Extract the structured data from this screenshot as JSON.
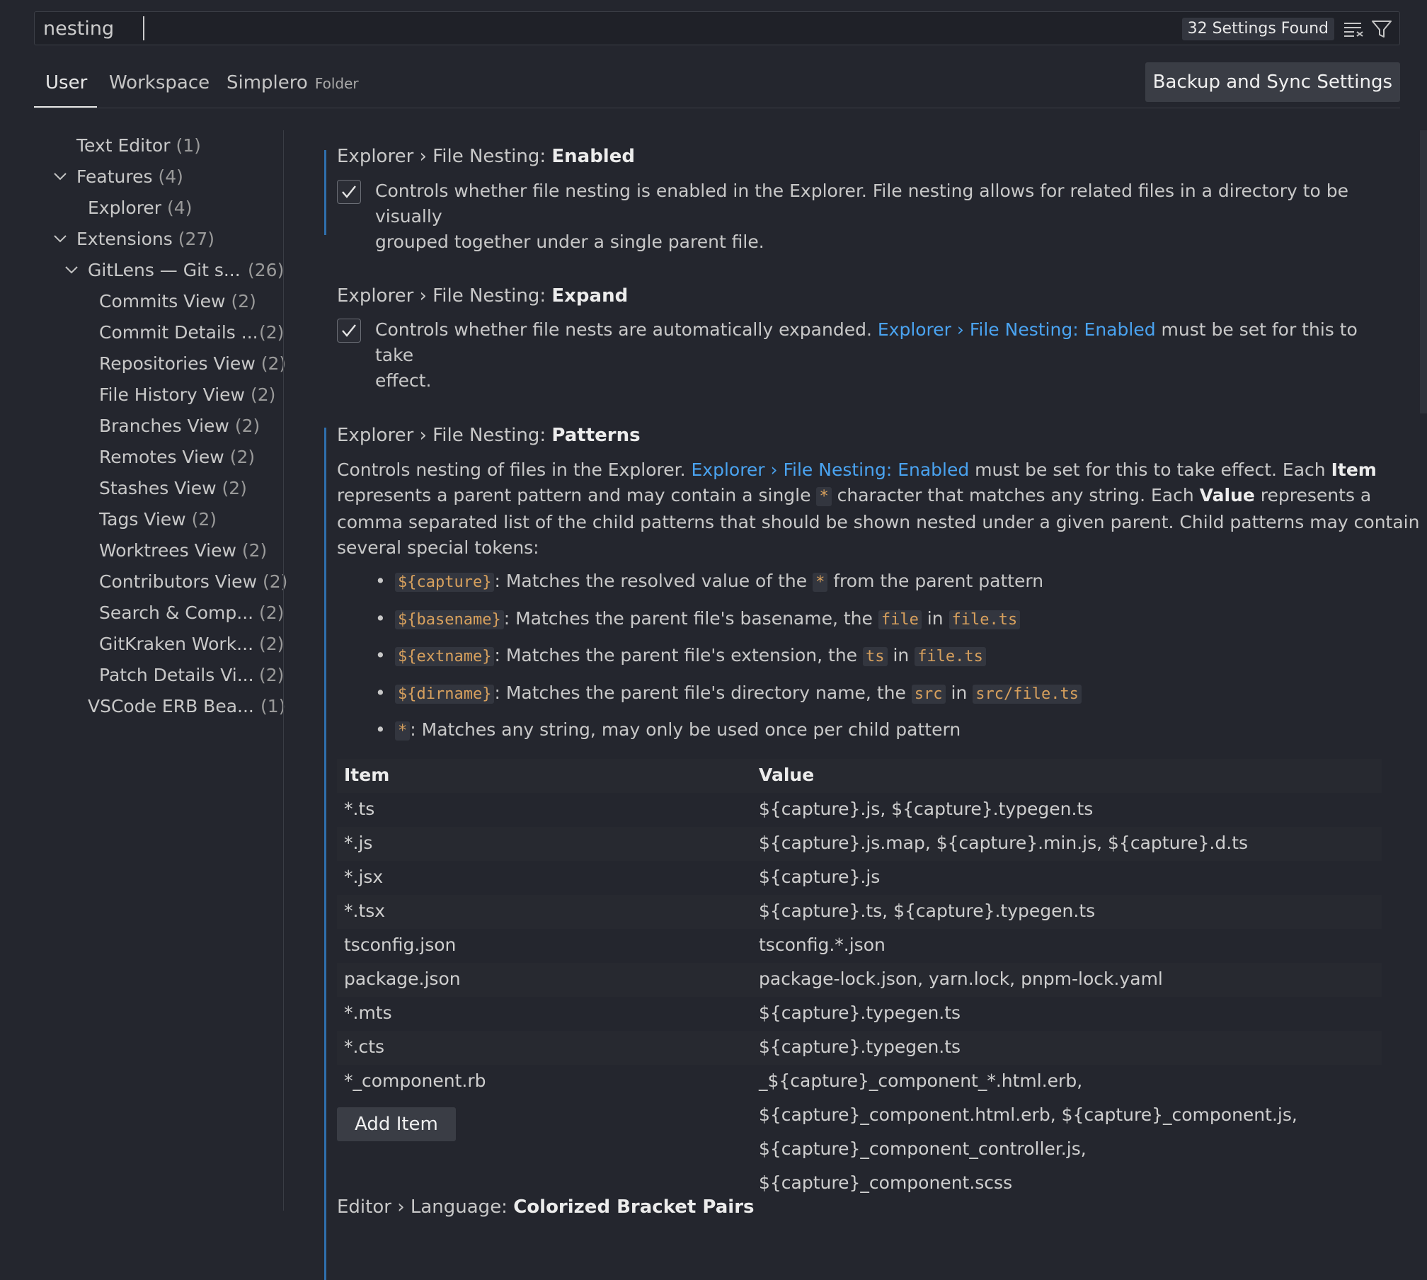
{
  "search": {
    "value": "nesting",
    "count_label": "32 Settings Found"
  },
  "tabs": [
    {
      "label": "User"
    },
    {
      "label": "Workspace"
    },
    {
      "label": "Simplero",
      "suffix": "Folder"
    }
  ],
  "sync_button_label": "Backup and Sync Settings",
  "toc": [
    {
      "label": "Text Editor",
      "count": "(1)"
    },
    {
      "label": "Features",
      "count": "(4)"
    },
    {
      "label": "Explorer",
      "count": "(4)"
    },
    {
      "label": "Extensions",
      "count": "(27)"
    },
    {
      "label": "GitLens — Git s...",
      "count": "(26)"
    },
    {
      "label": "Commits View",
      "count": "(2)"
    },
    {
      "label": "Commit Details ...",
      "count": "(2)"
    },
    {
      "label": "Repositories View",
      "count": "(2)"
    },
    {
      "label": "File History View",
      "count": "(2)"
    },
    {
      "label": "Branches View",
      "count": "(2)"
    },
    {
      "label": "Remotes View",
      "count": "(2)"
    },
    {
      "label": "Stashes View",
      "count": "(2)"
    },
    {
      "label": "Tags View",
      "count": "(2)"
    },
    {
      "label": "Worktrees View",
      "count": "(2)"
    },
    {
      "label": "Contributors View",
      "count": "(2)"
    },
    {
      "label": "Search & Comp...",
      "count": "(2)"
    },
    {
      "label": "GitKraken Work...",
      "count": "(2)"
    },
    {
      "label": "Patch Details Vi...",
      "count": "(2)"
    },
    {
      "label": "VSCode ERB Bea...",
      "count": "(1)"
    }
  ],
  "settings": {
    "enabled": {
      "prefix": "Explorer › File Nesting: ",
      "name": "Enabled",
      "checked": true,
      "desc_line1": "Controls whether file nesting is enabled in the Explorer. File nesting allows for related files in a directory to be visually",
      "desc_line2": "grouped together under a single parent file."
    },
    "expand": {
      "prefix": "Explorer › File Nesting: ",
      "name": "Expand",
      "checked": true,
      "desc_a": "Controls whether file nests are automatically expanded. ",
      "desc_link": "Explorer › File Nesting: Enabled",
      "desc_b": " must be set for this to take",
      "desc_line2": "effect."
    },
    "patterns": {
      "prefix": "Explorer › File Nesting: ",
      "name": "Patterns",
      "l1_a": "Controls nesting of files in the Explorer. ",
      "l1_link": "Explorer › File Nesting: Enabled",
      "l1_b": " must be set for this to take effect. Each ",
      "l1_bold": "Item",
      "l2_a": "represents a parent pattern and may contain a single ",
      "l2_code": "*",
      "l2_b": " character that matches any string. Each ",
      "l2_bold": "Value",
      "l2_c": " represents a",
      "l3": "comma separated list of the child patterns that should be shown nested under a given parent. Child patterns may contain",
      "l4": "several special tokens:",
      "bullets": [
        {
          "code": "${capture}",
          "text1": ": Matches the resolved value of the ",
          "code2": "*",
          "text2": " from the parent pattern",
          "text3": "",
          "code3": ""
        },
        {
          "code": "${basename}",
          "text1": ": Matches the parent file's basename, the ",
          "code2": "file",
          "text2": " in ",
          "code3": "file.ts",
          "text3": ""
        },
        {
          "code": "${extname}",
          "text1": ": Matches the parent file's extension, the ",
          "code2": "ts",
          "text2": " in ",
          "code3": "file.ts",
          "text3": ""
        },
        {
          "code": "${dirname}",
          "text1": ": Matches the parent file's directory name, the ",
          "code2": "src",
          "text2": " in ",
          "code3": "src/file.ts",
          "text3": ""
        },
        {
          "code": "*",
          "text1": ": Matches any string, may only be used once per child pattern",
          "code2": "",
          "text2": "",
          "code3": "",
          "text3": ""
        }
      ],
      "table": {
        "headers": [
          "Item",
          "Value"
        ],
        "rows": [
          [
            "*.ts",
            "${capture}.js, ${capture}.typegen.ts"
          ],
          [
            "*.js",
            "${capture}.js.map, ${capture}.min.js, ${capture}.d.ts"
          ],
          [
            "*.jsx",
            "${capture}.js"
          ],
          [
            "*.tsx",
            "${capture}.ts, ${capture}.typegen.ts"
          ],
          [
            "tsconfig.json",
            "tsconfig.*.json"
          ],
          [
            "package.json",
            "package-lock.json, yarn.lock, pnpm-lock.yaml"
          ],
          [
            "*.mts",
            "${capture}.typegen.ts"
          ],
          [
            "*.cts",
            "${capture}.typegen.ts"
          ],
          [
            "*_component.rb",
            "_${capture}_component_*.html.erb,"
          ],
          [
            "",
            "${capture}_component.html.erb, ${capture}_component.js,"
          ],
          [
            "",
            "${capture}_component_controller.js,"
          ],
          [
            "",
            "${capture}_component.scss"
          ]
        ]
      },
      "add_item_label": "Add Item"
    },
    "next": {
      "prefix": "Editor › Language: ",
      "name": "Colorized Bracket Pairs"
    }
  }
}
